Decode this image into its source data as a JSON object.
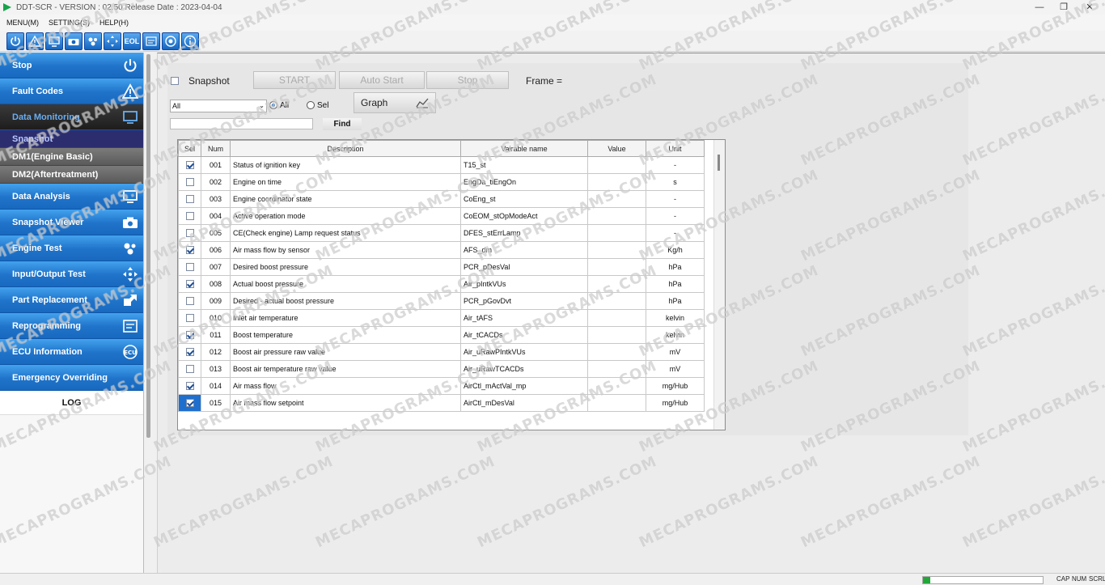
{
  "titlebar": {
    "title": "DDT-SCR - VERSION : 02.50 Release Date : 2023-04-04"
  },
  "menu": [
    "MENU(M)",
    "SETTING(S)",
    "HELP(H)"
  ],
  "toolbar": [
    "power-icon",
    "warning-icon",
    "monitor-icon",
    "camera-icon",
    "engine-test-icon",
    "io-test-icon",
    "eol-icon",
    "reprogram-icon",
    "ecu-icon",
    "info-icon"
  ],
  "sidebar": {
    "items": [
      {
        "label": "Stop",
        "icon": "power-icon"
      },
      {
        "label": "Fault Codes",
        "icon": "warning-icon"
      },
      {
        "label": "Data Monitoring",
        "icon": "monitor-icon"
      },
      {
        "label": "Data Analysis",
        "icon": "monitor-icon"
      },
      {
        "label": "Snapshot Viewer",
        "icon": "camera-icon"
      },
      {
        "label": "Engine Test",
        "icon": "engine-icon"
      },
      {
        "label": "Input/Output Test",
        "icon": "io-icon"
      },
      {
        "label": "Part Replacement",
        "icon": "part-icon"
      },
      {
        "label": "Reprogramming",
        "icon": "reprogram-icon"
      },
      {
        "label": "ECU Information",
        "icon": "ecu-icon"
      },
      {
        "label": "Emergency Overriding",
        "icon": "emergency-icon"
      }
    ],
    "subitems": [
      "Snapshot",
      "DM1(Engine Basic)",
      "DM2(Aftertreatment)"
    ],
    "log": "LOG"
  },
  "controls": {
    "snapshot_label": "Snapshot",
    "start": "START",
    "auto_start": "Auto Start",
    "stop": "Stop",
    "frame_label": "Frame =",
    "filter_value": "All",
    "radio_all": "All",
    "radio_sel": "Sel",
    "graph": "Graph",
    "find": "Find",
    "find_value": ""
  },
  "table": {
    "headers": {
      "sel": "Sel",
      "num": "Num",
      "desc": "Description",
      "var": "Vairable name",
      "value": "Value",
      "unit": "Unit"
    },
    "rows": [
      {
        "checked": true,
        "num": "001",
        "desc": "Status of ignition key",
        "var": "T15_st",
        "value": "",
        "unit": "-"
      },
      {
        "checked": false,
        "num": "002",
        "desc": "Engine on time",
        "var": "EngDa_tiEngOn",
        "value": "",
        "unit": "s"
      },
      {
        "checked": false,
        "num": "003",
        "desc": "Engine coordinator state",
        "var": "CoEng_st",
        "value": "",
        "unit": "-"
      },
      {
        "checked": false,
        "num": "004",
        "desc": "Active operation mode",
        "var": "CoEOM_stOpModeAct",
        "value": "",
        "unit": "-"
      },
      {
        "checked": false,
        "num": "005",
        "desc": "CE(Check engine) Lamp request status",
        "var": "DFES_stErrLamp",
        "value": "",
        "unit": "-"
      },
      {
        "checked": true,
        "num": "006",
        "desc": "Air mass flow by sensor",
        "var": "AFS_dm",
        "value": "",
        "unit": "Kg/h"
      },
      {
        "checked": false,
        "num": "007",
        "desc": "Desired boost pressure",
        "var": "PCR_pDesVal",
        "value": "",
        "unit": "hPa"
      },
      {
        "checked": true,
        "num": "008",
        "desc": "Actual boost pressure",
        "var": "Air_pIntkVUs",
        "value": "",
        "unit": "hPa"
      },
      {
        "checked": false,
        "num": "009",
        "desc": "Desired - actual boost pressure",
        "var": "PCR_pGovDvt",
        "value": "",
        "unit": "hPa"
      },
      {
        "checked": false,
        "num": "010",
        "desc": "Inlet air temperature",
        "var": "Air_tAFS",
        "value": "",
        "unit": "kelvin"
      },
      {
        "checked": true,
        "num": "011",
        "desc": "Boost temperature",
        "var": "Air_tCACDs",
        "value": "",
        "unit": "kelvin"
      },
      {
        "checked": true,
        "num": "012",
        "desc": "Boost air pressure raw value",
        "var": "Air_uRawPIntkVUs",
        "value": "",
        "unit": "mV"
      },
      {
        "checked": false,
        "num": "013",
        "desc": "Boost air temperature raw value",
        "var": "Air_uRawTCACDs",
        "value": "",
        "unit": "mV"
      },
      {
        "checked": true,
        "num": "014",
        "desc": "Air mass flow",
        "var": "AirCtl_mActVal_mp",
        "value": "",
        "unit": "mg/Hub"
      },
      {
        "checked": true,
        "num": "015",
        "desc": "Air mass flow setpoint",
        "var": "AirCtl_mDesVal",
        "value": "",
        "unit": "mg/Hub"
      }
    ]
  },
  "status": {
    "cap": "CAP",
    "num": "NUM",
    "scrl": "SCRL",
    "progress": 0.06
  },
  "watermark": "MECAPROGRAMS.COM"
}
